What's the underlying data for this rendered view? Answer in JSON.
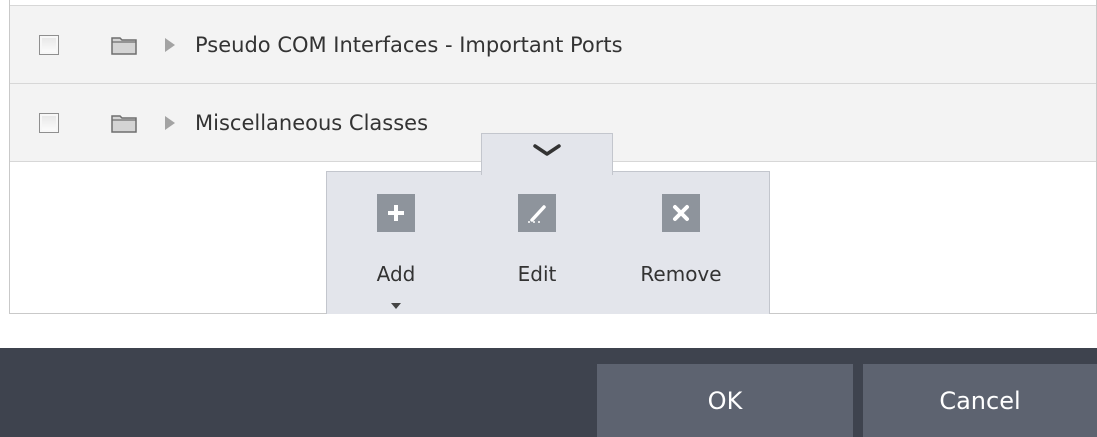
{
  "rows": [
    {
      "label": "Pseudo COM Interfaces - Important Ports",
      "checked": false
    },
    {
      "label": "Miscellaneous Classes",
      "checked": false
    }
  ],
  "toolbar": {
    "add_label": "Add",
    "edit_label": "Edit",
    "remove_label": "Remove"
  },
  "footer": {
    "ok_label": "OK",
    "cancel_label": "Cancel"
  },
  "colors": {
    "row_background": "#f3f3f3",
    "toolbar_background": "#e3e5eb",
    "icon_tile": "#8e949c",
    "footer_background": "#3e434e",
    "footer_button": "#5d6370"
  }
}
